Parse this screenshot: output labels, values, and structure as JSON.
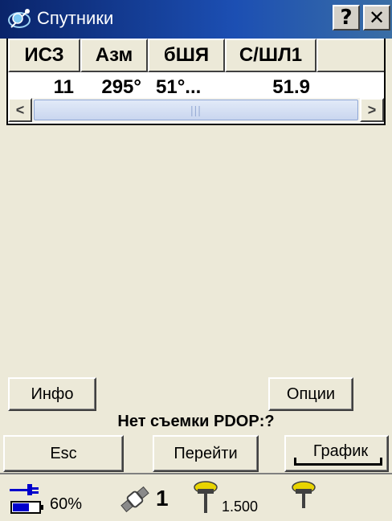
{
  "window": {
    "title": "Спутники"
  },
  "titlebar": {
    "help": "?",
    "close": "✕"
  },
  "table": {
    "columns": [
      "ИСЗ",
      "Азм",
      "бШЯ",
      "С/ШЛ1"
    ],
    "rows": [
      [
        "11",
        "295°",
        "51°...",
        "51.9"
      ]
    ]
  },
  "scrollbar": {
    "left": "<",
    "right": ">",
    "thumb_grip": "|||"
  },
  "buttons": {
    "info": "Инфо",
    "options": "Опции",
    "esc": "Esc",
    "go": "Перейти",
    "graph": "График"
  },
  "status": {
    "text": "Нет съемки  PDOP:?"
  },
  "statusbar": {
    "battery": "60%",
    "satellites": "1",
    "antenna_height": "1.500",
    "colors": {
      "battery": "#0000CC",
      "receiver": "#E8D400"
    }
  }
}
